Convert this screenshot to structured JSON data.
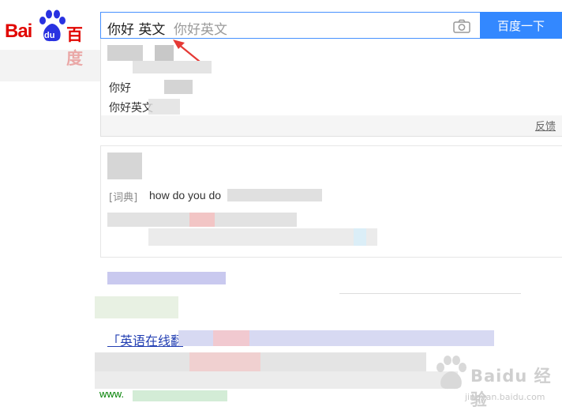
{
  "logo": {
    "bai": "Bai",
    "du": "du",
    "cn": "百度"
  },
  "search": {
    "query": "你好 英文",
    "suggestion": "你好英文",
    "button_label": "百度一下"
  },
  "dropdown": {
    "item_1": "你好",
    "item_2": "你好英文",
    "feedback": "反馈"
  },
  "card": {
    "dict_label": "[词典]",
    "dict_text": "how do you do"
  },
  "result": {
    "title": "「英语在线翻",
    "url": "www."
  },
  "watermark": {
    "brand": "Baidu 经验",
    "url": "jingyan.baidu.com"
  },
  "colors": {
    "brand_red": "#e10601",
    "brand_blue": "#2932e1",
    "search_button": "#3388ff",
    "link": "#2440b3"
  }
}
